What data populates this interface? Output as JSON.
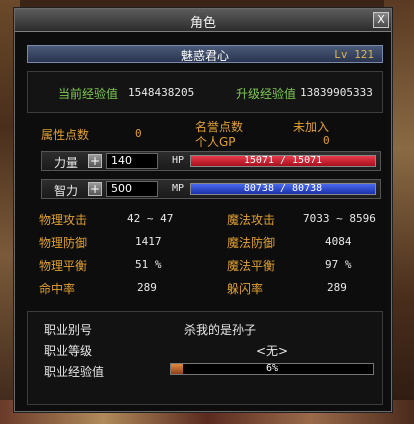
{
  "window": {
    "title": "角色",
    "close_label": "X"
  },
  "character": {
    "name": "魅惑君心",
    "level": "Lv 121"
  },
  "experience": {
    "current_label": "当前经验值",
    "current_value": "1548438205",
    "next_label": "升级经验值",
    "next_value": "13839905333"
  },
  "points": {
    "attr_label": "属性点数",
    "attr_value": "0",
    "honor_label": "名誉点数",
    "unjoined": "未加入",
    "gp_label": "个人GP",
    "gp_value": "0"
  },
  "stats": {
    "strength": {
      "label": "力量",
      "plus": "+",
      "value": "140",
      "bar_label": "HP",
      "bar_text": "15071 / 15071",
      "fill": 1.0
    },
    "intellect": {
      "label": "智力",
      "plus": "+",
      "value": "500",
      "bar_label": "MP",
      "bar_text": "80738 / 80738",
      "fill": 1.0
    }
  },
  "combat": [
    {
      "l_label": "物理攻击",
      "l_value": "42 ~ 47",
      "r_label": "魔法攻击",
      "r_value": "7033 ~ 8596"
    },
    {
      "l_label": "物理防御",
      "l_value": "1417",
      "r_label": "魔法防御",
      "r_value": "4084"
    },
    {
      "l_label": "物理平衡",
      "l_value": "51 %",
      "r_label": "魔法平衡",
      "r_value": "97 %"
    },
    {
      "l_label": "命中率",
      "l_value": "289",
      "r_label": "躲闪率",
      "r_value": "289"
    }
  ],
  "job": {
    "alias_label": "职业别号",
    "alias_value": "杀我的是孙子",
    "grade_label": "职业等级",
    "grade_value": "<无>",
    "exp_label": "职业经验值",
    "exp_text": "6%",
    "exp_fill": 0.06
  },
  "colors": {
    "hp": "#c8182a",
    "mp": "#2a48c8",
    "job_exp": "#c06a28"
  }
}
